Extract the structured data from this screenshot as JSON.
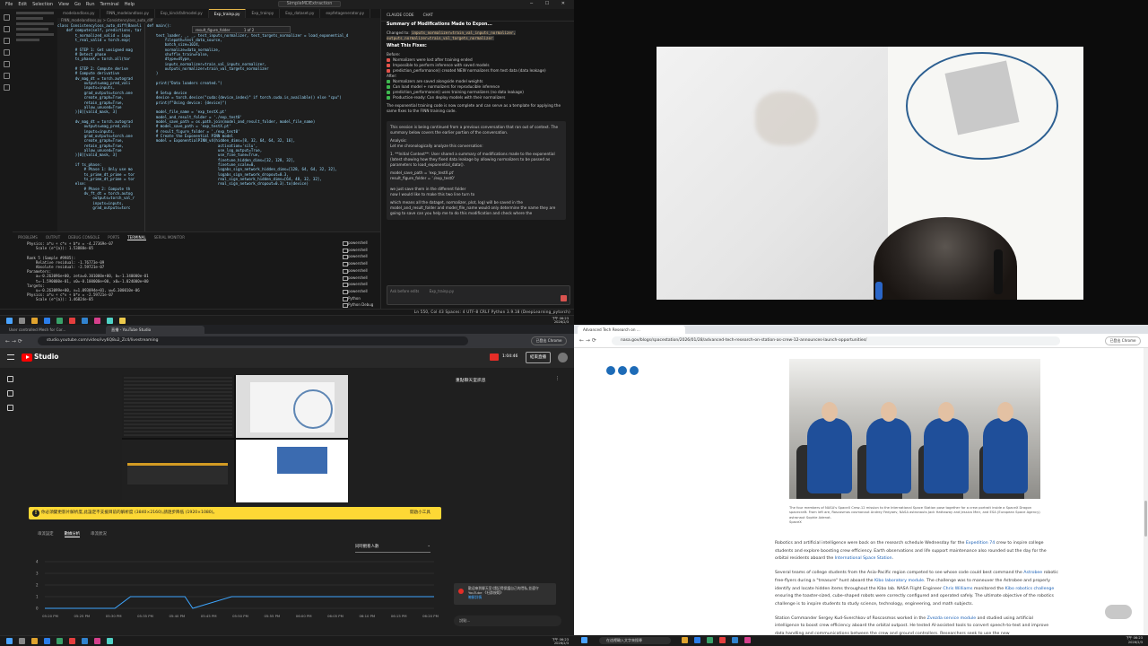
{
  "vscode": {
    "menu": [
      "File",
      "Edit",
      "Selection",
      "View",
      "Go",
      "Run",
      "Terminal",
      "Help"
    ],
    "search_box": "SimpleMDExtraction",
    "tabs": [
      "modelandloss.py",
      "FINN_modelandloss.py",
      "Exp_kinckfallmodel.py",
      "Exp_trainp.py",
      "Exp_trainpy",
      "Exp_dataset.py",
      "expfetagenerator.py"
    ],
    "active_tab_index": 3,
    "breadcrumb": "FINN_modelandloss.py > Consistencyloss_auto_diff",
    "find_text": "result_figure_folder",
    "find_count": "1 of 2",
    "code_left": "class Consistencyloss_auto_diff(Baseli\n    def compute(self, predictions, tar\n        t_normalized_valid = inpu\n        t_real_valid = torch.exp(\n\n        # STEP 1: Get unsigned mag\n        # Detect phase\n        ts_phaseX = torch.all(tor\n\n        # STEP 2: Compute derive\n        # Compute derivative\n        dv_mag_dt = torch.autograd\n            outputs=mag_pred_vali\n            inputs=inputs,\n            grad_outputs=torch.one\n            create_graph=True,\n            retain_graph=True,\n            allow_unused=True\n        )[0][valid_mask, 3]\n\n        dv_mag_dt = torch.autograd\n            outputs=mag_pred_vali\n            inputs=inputs,\n            grad_outputs=torch.one\n            create_graph=True,\n            retain_graph=True,\n            allow_unused=True\n        )[0][valid_mask, 3]\n\n        if ts_phase:\n            # Phase 1: Only use mo\n            ts_prime_dt_prime = tor\n            ts_prime_dt_prime = tor\n        else:\n            # Phase 2: Compute th\n            dv_ft_dt = torch.autog\n                outputs=torch_val_r\n                inputs=inputs,\n                grad_outputs=torc",
    "code_right": "def main():\n\n    test_loader, _, _, test_inputs_normalizer, test_targets_normalizer = load_exponential_d\n        filepath=test_data_source,\n        batch_size=1024,\n        normalize=data_normalize,\n        shuffle_train=False,\n        dtype=dtype,\n        inputs_normalizer=train_val_inputs_normalizer,\n        outputs_normalizer=train_val_targets_normalizer\n    )\n\n    print(\"Data loaders created.\")\n\n    # Setup device\n    device = torch.device(\"cuda:{device_index}\" if torch.cuda.is_available() else \"cpu\")\n    print(f\"Using device: {device}\")\n\n    model_file_name = 'exp_testX.pt'\n    model_and_result_folder = './exp_test0'\n    model_save_path = os.path.join(model_and_result_folder, model_file_name)\n    # model_save_path = 'exp_testX.pt'\n    # result_figure_folder = './exp_test0'\n    # Create the Exponential PINN model\n    model = ExponentialPINN_v4(hidden_dims=[8, 32, 64, 64, 32, 16],\n                                activation='silu',\n                                use_log_output=True,\n                                use_fine_tune=True,\n                                finetune_hidden_dims=[32, 128, 32],\n                                finetune_scale=0,\n                                logabs_sign_network_hidden_dims=[128, 64, 64, 32, 32],\n                                logabs_sign_network_dropout=0.3,\n                                real_sign_network_hidden_dims=[64, 48, 32, 32],\n                                real_sign_network_dropout=0.3).to(device)",
    "panel_tabs": [
      "PROBLEMS",
      "OUTPUT",
      "DEBUG CONSOLE",
      "PORTS",
      "TERMINAL",
      "SERIAL MONITOR"
    ],
    "active_panel_tab": 4,
    "terminal": "Physics: a*u + c*v + b*v = -4.27369e-07\n    Scale (e^{a}): 1.53888e-05\n\nRank 5 (Sample #9985):\n    Relative residual: -1.76773e-09\n    Absolute residual: -2.59721e-07\nParameters:\n    a=-0.263096e+00, zeta=0.301000e+00, b=-1.340000e-01\n    t=-1.590000e-01, x0=-0.100000e+00, x0=-1.024000e+00\nTargets:\n    u=-0.263099e+00, v=1.093094e+01, w=6.300010e-06\nPhysics: a*u + c*v + b*v = -2.59721e-07\n    Scale (e^{a}): 1.46824e-05",
    "terminals": [
      "powershell",
      "powershell",
      "powershell",
      "powershell",
      "powershell",
      "powershell",
      "powershell",
      "powershell",
      "Python",
      "Python Debug"
    ],
    "chat_tabs": [
      "CLAUDE CODE",
      "CHAT"
    ],
    "chat": {
      "heading": "Summary of Modifications Made to Expon...",
      "changed_label": "Changed to:",
      "changed_code": "inputs_normalizer=train_val_inputs_normalizer, outputs_normalizer=train_val_targets_normalizer",
      "fix_title": "What This Fixes:",
      "before_label": "Before:",
      "before_items": [
        "Normalizers were lost after training ended",
        "Impossible to perform inference with saved models",
        "prediction_performance() created NEW normalizers from test data (data leakage)"
      ],
      "after_label": "After:",
      "after_items": [
        "Normalizers are saved alongside model weights",
        "Can load model + normalizers for reproducible inference",
        "prediction_performance() uses training normalizers (no data leakage)",
        "Production-ready: Can deploy models with their normalizers"
      ],
      "conclusion": "The exponential training code is now complete and can serve as a template for applying the same fixes to the FINN training code.",
      "msg1": "This session is being continued from a previous conversation that ran out of context. The summary below covers the earlier portion of the conversation.",
      "msg2": "Analysis:\nLet me chronologically analyze this conversation:",
      "msg3": "1. **Initial Context**: User shared a summary of modifications made to the exponential (latest showing how they fixed data leakage by allowing normalizers to be passed as parameters to load_exponential_data().",
      "msg4": "model_save_path = 'exp_testX.pt'\nresult_figure_folder = './exp_test0'\n\nwe just save them in the different folder\nnow I would like to make this two line turn to",
      "msg5": "which means all the dataget, normalizer, plot, log) will be saved in the model_and_result_folder and model_file_name would only determine the name they are going to save\ncan you help me to do this modification and check where the",
      "input_placeholder": "Ask before edits",
      "input_file": "Exp_trainp.py"
    },
    "status": "Ln 550, Col 43   Spaces: 4   UTF-8   CRLF   Python   3.9.18 (DeepLearning_pytorch)",
    "clock_time": "下午 06:23",
    "clock_date": "2026/2/3"
  },
  "studio": {
    "tabs": [
      "User controlled Mesh for Cor...",
      "直播 - YouTube Studio"
    ],
    "url": "studio.youtube.com/video/ivy6Q8u2_Zc4/livestreaming",
    "profile_btn": "已登出 Chrome",
    "brand": "Studio",
    "live_time": "1:04:46",
    "end_button": "結束直播",
    "chat_title": "重點聊天室訊息",
    "warning": "你必須變更影片解析度,此設定不支援目前的解析度 (3840×2160),請逐步降低 (1920×1080)。",
    "warning_action": "開啟小工具",
    "analytics_tabs": [
      "串流設定",
      "數據分析",
      "串流狀況"
    ],
    "active_analytics": 1,
    "metric_select": "同時觀看人數",
    "chat_note": "歡迎來到聊天室!請記得保護自己的隱私,並遵守 YouTube 《社群規範》",
    "chat_note_link": "瞭解詳情",
    "say_placeholder": "說點...",
    "clock_time": "下午 06:23",
    "clock_date": "2026/2/3"
  },
  "chart_data": {
    "type": "line",
    "title": "",
    "xlabel": "",
    "ylabel": "",
    "categories": [
      "05:20 PM",
      "05:25 PM",
      "05:30 PM",
      "05:35 PM",
      "05:40 PM",
      "05:45 PM",
      "05:50 PM",
      "05:55 PM",
      "06:00 PM",
      "06:05 PM",
      "06:10 PM",
      "06:15 PM",
      "06:20 PM"
    ],
    "y_ticks": [
      0,
      1,
      2,
      3,
      4
    ],
    "ylim": [
      0,
      4
    ],
    "x": [
      0,
      0.12,
      0.18,
      0.22,
      0.36,
      0.38,
      0.48,
      0.49,
      1
    ],
    "values": [
      0,
      0,
      0,
      1,
      1,
      0,
      1,
      1,
      1
    ],
    "grid": true,
    "color": "#3ea6ff"
  },
  "nasa": {
    "tab": "Advanced Tech Research on ...",
    "url": "nasa.gov/blogs/spacestation/2026/01/28/advanced-tech-research-on-station-as-crew-12-announces-launch-opportunities/",
    "profile_btn": "已登出 Chrome",
    "caption": "The four members of NASA's SpaceX Crew-12 mission to the International Space Station pose together for a crew portrait inside a SpaceX Dragon spacecraft. From left are, Roscosmos cosmonaut Andrey Fedyaev, NASA astronauts Jack Hathaway and Jessica Meir, and ESA (European Space Agency) astronaut Sophie Adenot.",
    "credit": "SpaceX",
    "p1_a": "Robotics and artificial intelligence were back on the research schedule Wednesday for the ",
    "p1_link1": "Expedition 74",
    "p1_b": " crew to inspire college students and explore boosting crew efficiency. Earth observations and life support maintenance also rounded out the day for the orbital residents aboard the ",
    "p1_link2": "International Space Station",
    "p1_c": ".",
    "p2_a": "Several teams of college students from the Asia-Pacific region competed to see whose code could best command the ",
    "p2_link1": "Astrobee",
    "p2_b": " robotic free-flyers during a \"treasure\" hunt aboard the ",
    "p2_link2": "Kibo laboratory module",
    "p2_c": ". The challenge was to maneuver the Astrobee and properly identify and locate hidden items throughout the Kibo lab. NASA Flight Engineer ",
    "p2_link3": "Chris Williams",
    "p2_d": " monitored the ",
    "p2_link4": "Kibo robotics challenge",
    "p2_e": " ensuring the toaster-sized, cube-shaped robots were correctly configured and operated safely. The ultimate objective of the robotics challenge is to inspire students to study science, technology, engineering, and math subjects.",
    "p3_a": "Station Commander Sergey Kud-Sverchkov of Roscosmos worked in the ",
    "p3_link1": "Zvezda service module",
    "p3_b": " and studied using artificial intelligence to boost crew efficiency aboard the orbital outpost. He tested AI-assisted tools to convert speech-to-text and improve data handling and communications between the crew and ground controllers. Researchers seek to use the new",
    "search_placeholder": "在這裡輸入文字來搜尋",
    "clock_time": "下午 06:23",
    "clock_date": "2026/2/3"
  }
}
